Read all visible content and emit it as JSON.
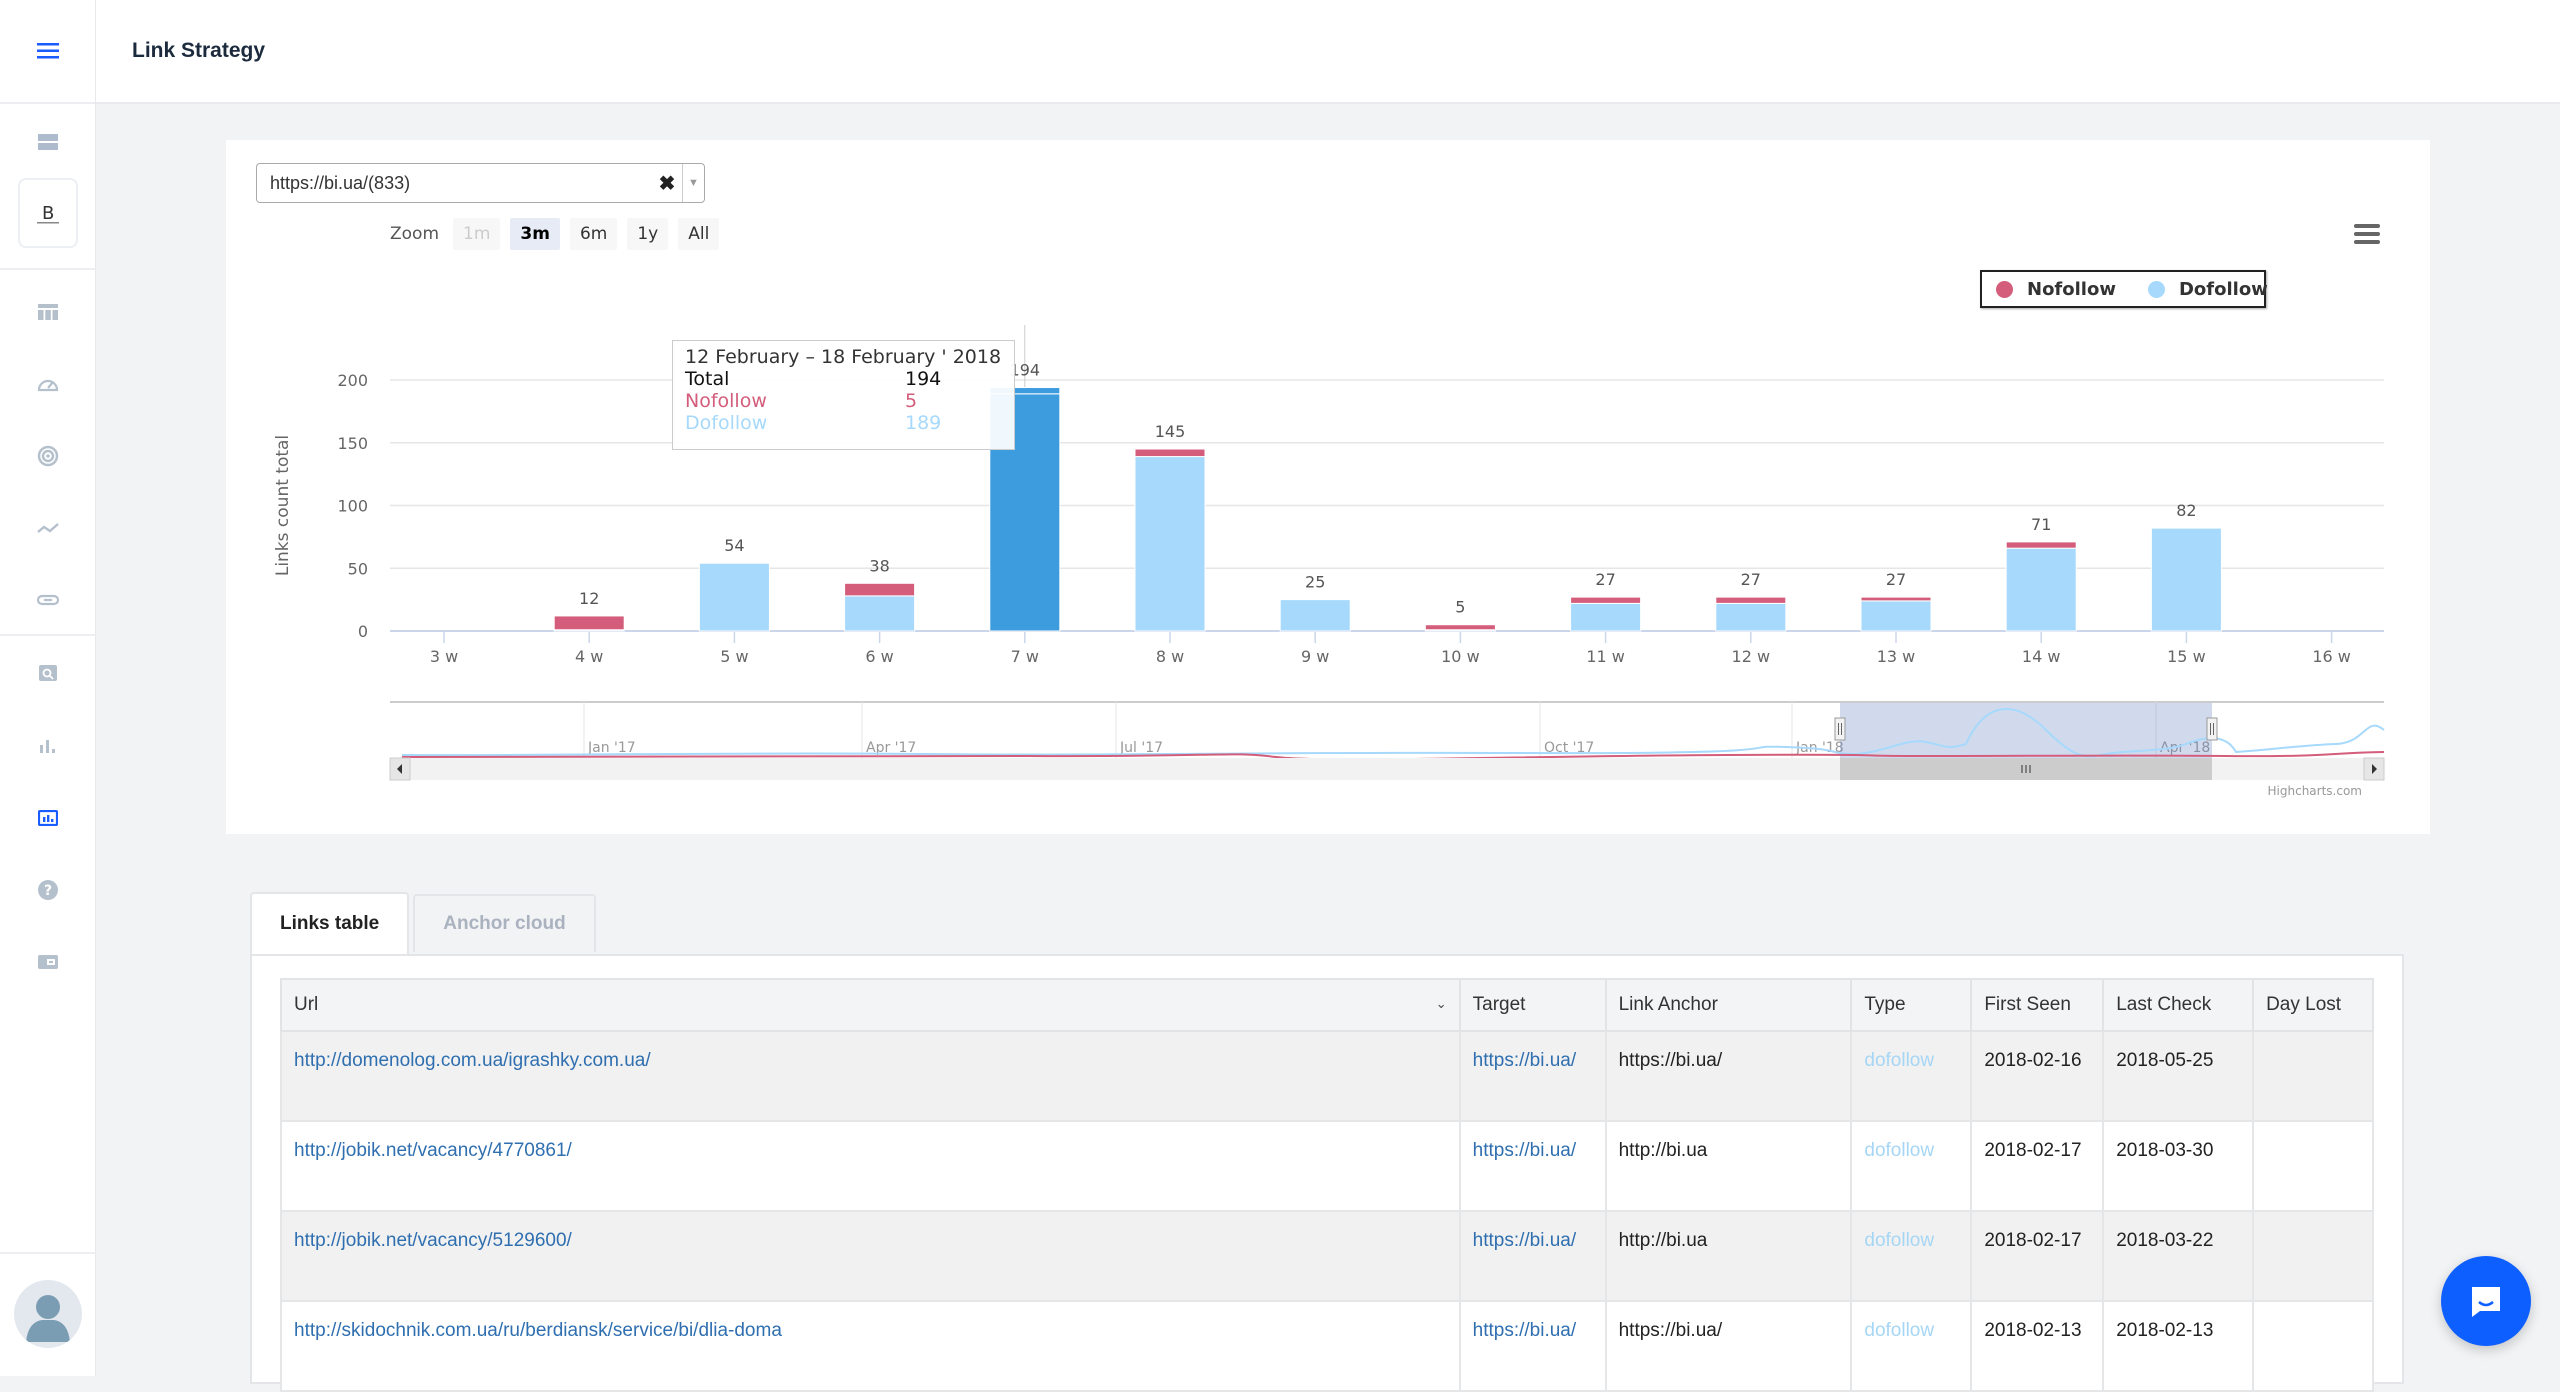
{
  "header": {
    "title": "Link Strategy"
  },
  "sidebar": {
    "icons": [
      "menu-icon",
      "server-icon",
      "logo",
      "table-icon",
      "speedometer-icon",
      "radar-icon",
      "trend-line-icon",
      "link-icon",
      "search-doc-icon",
      "bar-chart-icon",
      "report-chart-icon",
      "help-icon",
      "wallet-icon"
    ],
    "active": "report-chart-icon",
    "accent": "#1a5cff"
  },
  "selector": {
    "value": "https://bi.ua/(833)"
  },
  "zoom": {
    "label": "Zoom",
    "buttons": [
      {
        "label": "1m",
        "state": "disabled"
      },
      {
        "label": "3m",
        "state": "active"
      },
      {
        "label": "6m",
        "state": "normal"
      },
      {
        "label": "1y",
        "state": "normal"
      },
      {
        "label": "All",
        "state": "normal"
      }
    ]
  },
  "legend": {
    "items": [
      {
        "label": "Nofollow",
        "color": "#d35d7a"
      },
      {
        "label": "Dofollow",
        "color": "#a6d9fb"
      }
    ]
  },
  "tooltip": {
    "title": "12 February – 18 February ' 2018",
    "rows": [
      {
        "label": "Total",
        "value": "194",
        "color": "#111111"
      },
      {
        "label": "Nofollow",
        "value": "5",
        "color": "#d35d7a"
      },
      {
        "label": "Dofollow",
        "value": "189",
        "color": "#a6d9fb"
      }
    ]
  },
  "chart_data": {
    "type": "bar",
    "stacked": true,
    "title": "",
    "xlabel": "",
    "ylabel": "Links count total",
    "ylim": [
      0,
      200
    ],
    "yticks": [
      0,
      50,
      100,
      150,
      200
    ],
    "categories": [
      "3 w",
      "4 w",
      "5 w",
      "6 w",
      "7 w",
      "8 w",
      "9 w",
      "10 w",
      "11 w",
      "12 w",
      "13 w",
      "14 w",
      "15 w",
      "16 w"
    ],
    "totals": [
      null,
      12,
      54,
      38,
      194,
      145,
      25,
      5,
      27,
      27,
      27,
      71,
      82,
      null
    ],
    "series": [
      {
        "name": "Dofollow",
        "color": "#a6d9fb",
        "values": [
          0,
          1,
          54,
          28,
          189,
          139,
          25,
          1,
          22,
          22,
          24,
          66,
          82,
          0
        ]
      },
      {
        "name": "Nofollow",
        "color": "#d35d7a",
        "values": [
          0,
          11,
          0,
          10,
          5,
          6,
          0,
          4,
          5,
          5,
          3,
          5,
          0,
          0
        ]
      }
    ],
    "highlighted_index": 4,
    "highlight_color": "#3d9cdd",
    "legend_position": "top-right",
    "grid": true,
    "navigator": {
      "labels": [
        "Jan '17",
        "Apr '17",
        "Jul '17",
        "Oct '17",
        "Jan '18",
        "Apr '18"
      ],
      "selected_range": "3m"
    },
    "credits": "Highcharts.com"
  },
  "tabs": [
    {
      "label": "Links table",
      "active": true
    },
    {
      "label": "Anchor cloud",
      "active": false
    }
  ],
  "table": {
    "columns": [
      "Url",
      "Target",
      "Link Anchor",
      "Type",
      "First Seen",
      "Last Check",
      "Day Lost"
    ],
    "rows": [
      {
        "url": "http://domenolog.com.ua/igrashky.com.ua/",
        "target": "https://bi.ua/",
        "anchor": "https://bi.ua/",
        "type": "dofollow",
        "first_seen": "2018-02-16",
        "last_check": "2018-05-25",
        "day_lost": ""
      },
      {
        "url": "http://jobik.net/vacancy/4770861/",
        "target": "https://bi.ua/",
        "anchor": "http://bi.ua",
        "type": "dofollow",
        "first_seen": "2018-02-17",
        "last_check": "2018-03-30",
        "day_lost": ""
      },
      {
        "url": "http://jobik.net/vacancy/5129600/",
        "target": "https://bi.ua/",
        "anchor": "http://bi.ua",
        "type": "dofollow",
        "first_seen": "2018-02-17",
        "last_check": "2018-03-22",
        "day_lost": ""
      },
      {
        "url": "http://skidochnik.com.ua/ru/berdiansk/service/bi/dlia-doma",
        "target": "https://bi.ua/",
        "anchor": "https://bi.ua/",
        "type": "dofollow",
        "first_seen": "2018-02-13",
        "last_check": "2018-02-13",
        "day_lost": ""
      }
    ]
  }
}
